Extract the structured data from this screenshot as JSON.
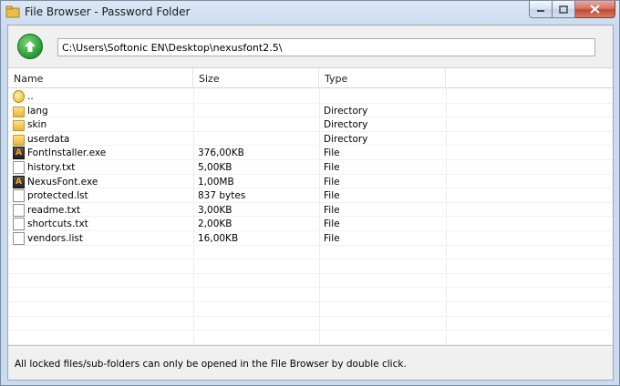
{
  "window": {
    "title": "File Browser - Password Folder",
    "accent_color": "#c9dbef",
    "close_color": "#c14a33"
  },
  "toolbar": {
    "up_icon": "up-arrow-icon",
    "path": "C:\\Users\\Softonic EN\\Desktop\\nexusfont2.5\\"
  },
  "columns": [
    "Name",
    "Size",
    "Type"
  ],
  "files": [
    {
      "name": "..",
      "size": "",
      "type": "",
      "icon": "parent-folder-icon"
    },
    {
      "name": "lang",
      "size": "",
      "type": "Directory",
      "icon": "folder-icon"
    },
    {
      "name": "skin",
      "size": "",
      "type": "Directory",
      "icon": "folder-icon"
    },
    {
      "name": "userdata",
      "size": "",
      "type": "Directory",
      "icon": "folder-icon"
    },
    {
      "name": "FontInstaller.exe",
      "size": "376,00KB",
      "type": "File",
      "icon": "exe-icon"
    },
    {
      "name": "history.txt",
      "size": "5,00KB",
      "type": "File",
      "icon": "file-icon"
    },
    {
      "name": "NexusFont.exe",
      "size": "1,00MB",
      "type": "File",
      "icon": "exe-icon"
    },
    {
      "name": "protected.lst",
      "size": "837 bytes",
      "type": "File",
      "icon": "file-icon"
    },
    {
      "name": "readme.txt",
      "size": "3,00KB",
      "type": "File",
      "icon": "file-icon"
    },
    {
      "name": "shortcuts.txt",
      "size": "2,00KB",
      "type": "File",
      "icon": "file-icon"
    },
    {
      "name": "vendors.list",
      "size": "16,00KB",
      "type": "File",
      "icon": "file-icon"
    }
  ],
  "status": "All locked files/sub-folders can only be opened in the File Browser by double click."
}
